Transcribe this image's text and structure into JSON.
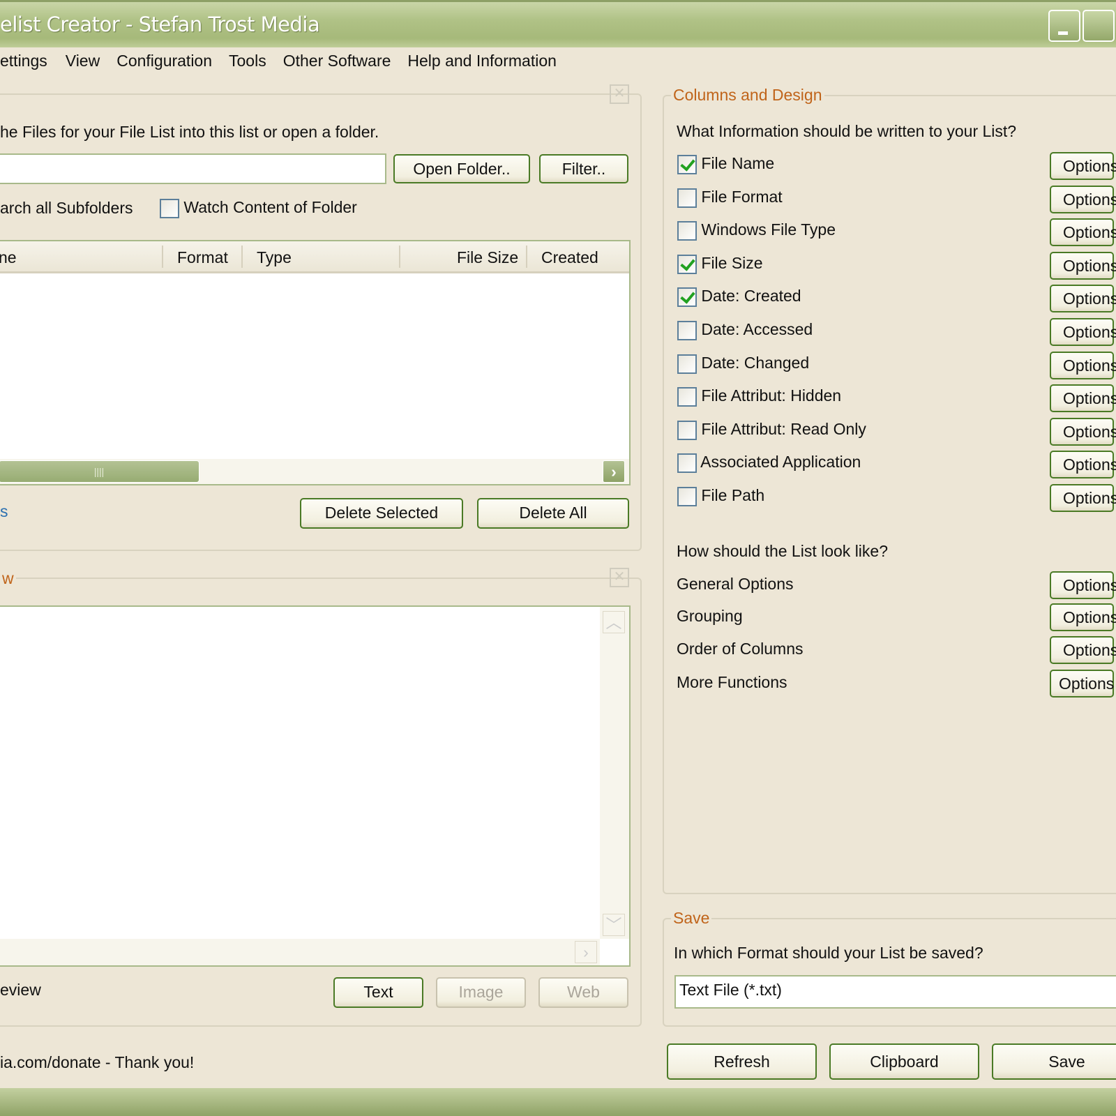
{
  "window": {
    "title": "elist Creator - Stefan Trost Media"
  },
  "menu": [
    "ettings",
    "View",
    "Configuration",
    "Tools",
    "Other Software",
    "Help and Information"
  ],
  "files": {
    "instruction": "he Files for your File List into this list or open a folder.",
    "folder_value": "",
    "open_folder": "Open Folder..",
    "filter": "Filter..",
    "search_subfolders": "arch all Subfolders",
    "watch_content": "Watch Content of Folder",
    "watch_checked": false,
    "columns": [
      "ne",
      "Format",
      "Type",
      "File Size",
      "Created"
    ],
    "count_label": "s",
    "delete_selected": "Delete Selected",
    "delete_all": "Delete All"
  },
  "preview": {
    "label": "w",
    "mode_label": "eview",
    "text": "Text",
    "image": "Image",
    "web": "Web"
  },
  "donate": "ia.com/donate - Thank you!",
  "columns_design": {
    "label": "Columns and Design",
    "question": "What Information should be written to your List?",
    "items": [
      {
        "label": "File Name",
        "checked": true
      },
      {
        "label": "File Format",
        "checked": false
      },
      {
        "label": "Windows File Type",
        "checked": false
      },
      {
        "label": "File Size",
        "checked": true
      },
      {
        "label": "Date: Created",
        "checked": true
      },
      {
        "label": "Date: Accessed",
        "checked": false
      },
      {
        "label": "Date: Changed",
        "checked": false
      },
      {
        "label": "File Attribut: Hidden",
        "checked": false
      },
      {
        "label": "File Attribut: Read Only",
        "checked": false
      },
      {
        "label": "Associated Application",
        "checked": false
      },
      {
        "label": "File Path",
        "checked": false
      }
    ],
    "options_label": "Options",
    "look_question": "How should the List look like?",
    "look_items": [
      "General Options",
      "Grouping",
      "Order of Columns",
      "More Functions"
    ]
  },
  "save": {
    "label": "Save",
    "question": "In which Format should your List be saved?",
    "format": "Text File (*.txt)"
  },
  "footer": {
    "refresh": "Refresh",
    "clipboard": "Clipboard",
    "save": "Save"
  }
}
